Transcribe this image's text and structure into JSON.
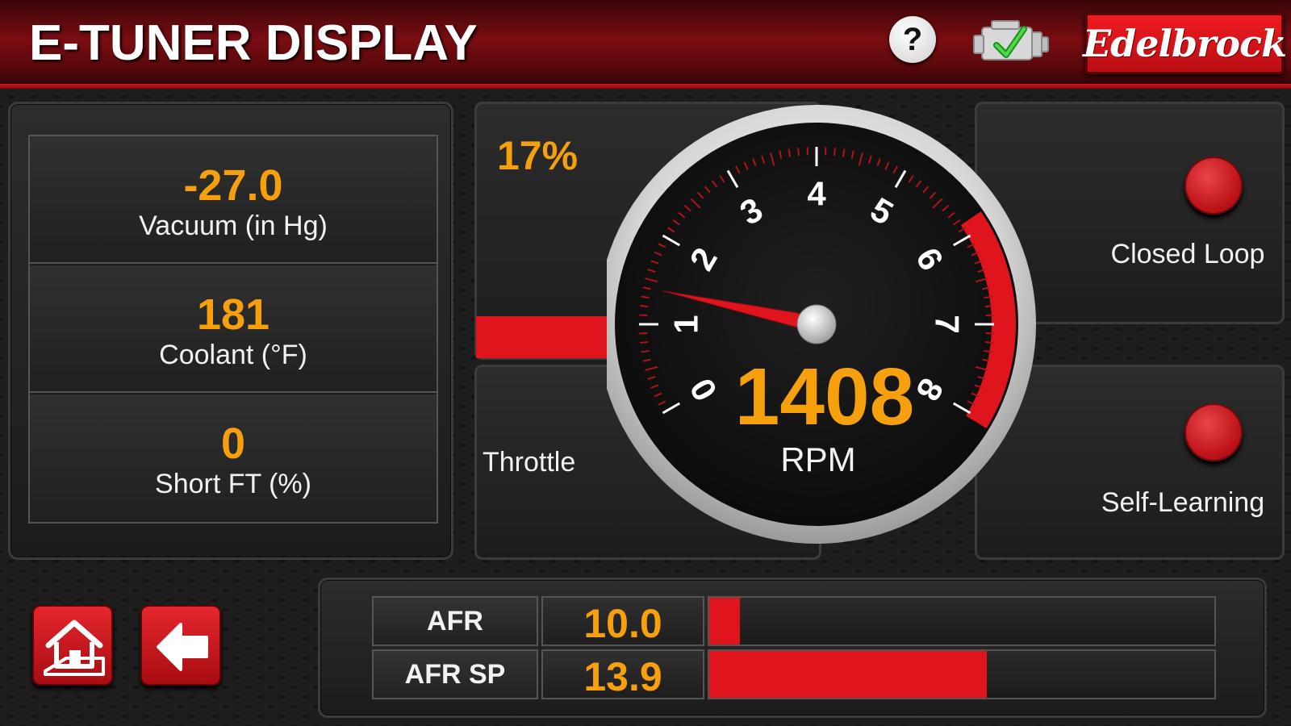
{
  "header": {
    "title": "E-TUNER DISPLAY",
    "help_label": "?",
    "engine_status_icon": "engine-check-icon",
    "brand_logo": "Edelbrock"
  },
  "left_readouts": [
    {
      "value": "-27.0",
      "label": "Vacuum (in Hg)"
    },
    {
      "value": "181",
      "label": "Coolant (°F)"
    },
    {
      "value": "0",
      "label": "Short FT (%)"
    }
  ],
  "throttle": {
    "value_text": "17%",
    "fraction": 0.17,
    "label": "Throttle"
  },
  "tachometer": {
    "rpm_value": "1408",
    "rpm_label": "RPM",
    "scale_min": 0,
    "scale_max": 8,
    "tick_labels": [
      "0",
      "1",
      "2",
      "3",
      "4",
      "5",
      "6",
      "7",
      "8"
    ],
    "redline_start": 6,
    "needle_value": 1.408
  },
  "status_lights": [
    {
      "label": "Closed Loop",
      "state": "off",
      "color": "#c0141a"
    },
    {
      "label": "Self-Learning",
      "state": "off",
      "color": "#c0141a"
    }
  ],
  "afr": [
    {
      "name": "AFR",
      "value": "10.0",
      "bar_fraction": 0.06
    },
    {
      "name": "AFR SP",
      "value": "13.9",
      "bar_fraction": 0.55
    }
  ],
  "nav": {
    "home_icon": "home-icon",
    "back_icon": "back-arrow-icon"
  },
  "colors": {
    "accent": "#f6a00e",
    "brand_red": "#e0141c"
  }
}
